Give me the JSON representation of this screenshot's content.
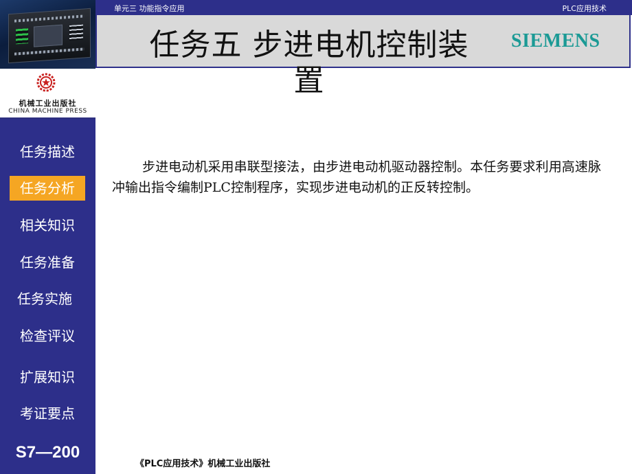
{
  "header": {
    "unit": "单元三 功能指令应用",
    "course": "PLC应用技术"
  },
  "title": "任务五  步进电机控制装置",
  "brand": "SIEMENS",
  "publisher": {
    "name_cn": "机械工业出版社",
    "name_en": "CHINA MACHINE PRESS"
  },
  "sidebar": {
    "items": [
      {
        "label": "任务描述"
      },
      {
        "label": "任务分析"
      },
      {
        "label": "相关知识"
      },
      {
        "label": "任务准备"
      },
      {
        "label": "任务实施"
      },
      {
        "label": "检查评议"
      },
      {
        "label": "扩展知识"
      },
      {
        "label": "考证要点"
      }
    ],
    "active_index": 1,
    "series": "S7—200"
  },
  "body": "步进电动机采用串联型接法，由步进电动机驱动器控制。本任务要求利用高速脉冲输出指令编制PLC控制程序，实现步进电动机的正反转控制。",
  "footer": "《PLC应用技术》机械工业出版社",
  "colors": {
    "navy": "#2d2f8a",
    "active": "#f5a623",
    "brand": "#1b9a95",
    "banner": "#d9d9d9"
  }
}
